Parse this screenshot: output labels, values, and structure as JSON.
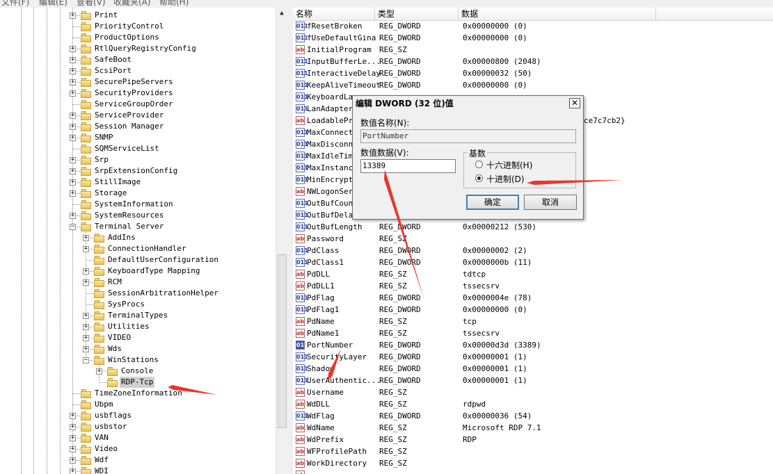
{
  "menubar": {
    "items": [
      "文件(F)",
      "编辑(E)",
      "查看(V)",
      "收藏夹(A)",
      "帮助(H)"
    ]
  },
  "tree": {
    "items": [
      {
        "label": "Print",
        "level": 0,
        "expander": "plus"
      },
      {
        "label": "PriorityControl",
        "level": 0,
        "expander": "none"
      },
      {
        "label": "ProductOptions",
        "level": 0,
        "expander": "none"
      },
      {
        "label": "RtlQueryRegistryConfig",
        "level": 0,
        "expander": "plus"
      },
      {
        "label": "SafeBoot",
        "level": 0,
        "expander": "plus"
      },
      {
        "label": "ScsiPort",
        "level": 0,
        "expander": "plus"
      },
      {
        "label": "SecurePipeServers",
        "level": 0,
        "expander": "plus"
      },
      {
        "label": "SecurityProviders",
        "level": 0,
        "expander": "plus"
      },
      {
        "label": "ServiceGroupOrder",
        "level": 0,
        "expander": "none"
      },
      {
        "label": "ServiceProvider",
        "level": 0,
        "expander": "plus"
      },
      {
        "label": "Session Manager",
        "level": 0,
        "expander": "plus"
      },
      {
        "label": "SNMP",
        "level": 0,
        "expander": "plus"
      },
      {
        "label": "SQMServiceList",
        "level": 0,
        "expander": "none"
      },
      {
        "label": "Srp",
        "level": 0,
        "expander": "plus"
      },
      {
        "label": "SrpExtensionConfig",
        "level": 0,
        "expander": "plus"
      },
      {
        "label": "StillImage",
        "level": 0,
        "expander": "plus"
      },
      {
        "label": "Storage",
        "level": 0,
        "expander": "plus"
      },
      {
        "label": "SystemInformation",
        "level": 0,
        "expander": "none"
      },
      {
        "label": "SystemResources",
        "level": 0,
        "expander": "plus"
      },
      {
        "label": "Terminal Server",
        "level": 0,
        "expander": "minus"
      },
      {
        "label": "AddIns",
        "level": 1,
        "expander": "plus"
      },
      {
        "label": "ConnectionHandler",
        "level": 1,
        "expander": "plus"
      },
      {
        "label": "DefaultUserConfiguration",
        "level": 1,
        "expander": "none"
      },
      {
        "label": "KeyboardType Mapping",
        "level": 1,
        "expander": "plus"
      },
      {
        "label": "RCM",
        "level": 1,
        "expander": "plus"
      },
      {
        "label": "SessionArbitrationHelper",
        "level": 1,
        "expander": "none"
      },
      {
        "label": "SysProcs",
        "level": 1,
        "expander": "none"
      },
      {
        "label": "TerminalTypes",
        "level": 1,
        "expander": "plus"
      },
      {
        "label": "Utilities",
        "level": 1,
        "expander": "plus"
      },
      {
        "label": "VIDEO",
        "level": 1,
        "expander": "plus"
      },
      {
        "label": "Wds",
        "level": 1,
        "expander": "plus"
      },
      {
        "label": "WinStations",
        "level": 1,
        "expander": "minus"
      },
      {
        "label": "Console",
        "level": 2,
        "expander": "plus"
      },
      {
        "label": "RDP-Tcp",
        "level": 2,
        "expander": "none",
        "selected": true
      },
      {
        "label": "TimeZoneInformation",
        "level": 0,
        "expander": "none"
      },
      {
        "label": "Ubpm",
        "level": 0,
        "expander": "none"
      },
      {
        "label": "usbflags",
        "level": 0,
        "expander": "plus"
      },
      {
        "label": "usbstor",
        "level": 0,
        "expander": "plus"
      },
      {
        "label": "VAN",
        "level": 0,
        "expander": "plus"
      },
      {
        "label": "Video",
        "level": 0,
        "expander": "plus"
      },
      {
        "label": "Wdf",
        "level": 0,
        "expander": "plus"
      },
      {
        "label": "WDI",
        "level": 0,
        "expander": "plus"
      }
    ]
  },
  "scrollbar": {
    "up_icon": "▲"
  },
  "list": {
    "columns": {
      "name": "名称",
      "type": "类型",
      "data": "数据"
    },
    "rows": [
      {
        "name": "fResetBroken",
        "type": "REG_DWORD",
        "data": "0x00000000 (0)",
        "icon": "dword"
      },
      {
        "name": "fUseDefaultGina",
        "type": "REG_DWORD",
        "data": "0x00000000 (0)",
        "icon": "dword"
      },
      {
        "name": "InitialProgram",
        "type": "REG_SZ",
        "data": "",
        "icon": "sz"
      },
      {
        "name": "InputBufferLe...",
        "type": "REG_DWORD",
        "data": "0x00000800 (2048)",
        "icon": "dword"
      },
      {
        "name": "InteractiveDelay",
        "type": "REG_DWORD",
        "data": "0x00000032 (50)",
        "icon": "dword"
      },
      {
        "name": "KeepAliveTimeout",
        "type": "REG_DWORD",
        "data": "0x00000000 (0)",
        "icon": "dword"
      },
      {
        "name": "KeyboardLay",
        "type": "",
        "data": "",
        "icon": "dword"
      },
      {
        "name": "LanAdapter",
        "type": "",
        "data": "",
        "icon": "dword"
      },
      {
        "name": "LoadablePro",
        "type": "",
        "data": "ce7c7cb2}",
        "icon": "sz"
      },
      {
        "name": "MaxConnecti",
        "type": "",
        "data": "",
        "icon": "dword"
      },
      {
        "name": "MaxDisconne",
        "type": "",
        "data": "",
        "icon": "dword"
      },
      {
        "name": "MaxIdleTime",
        "type": "",
        "data": "",
        "icon": "dword"
      },
      {
        "name": "MaxInstance",
        "type": "",
        "data": "",
        "icon": "dword"
      },
      {
        "name": "MinEncrypti",
        "type": "",
        "data": "",
        "icon": "dword"
      },
      {
        "name": "NWLogonServ",
        "type": "",
        "data": "",
        "icon": "sz"
      },
      {
        "name": "OutBufCount",
        "type": "",
        "data": "",
        "icon": "dword"
      },
      {
        "name": "OutBufDelay",
        "type": "",
        "data": "",
        "icon": "dword"
      },
      {
        "name": "OutBufLength",
        "type": "REG_DWORD",
        "data": "0x00000212 (530)",
        "icon": "dword"
      },
      {
        "name": "Password",
        "type": "REG_SZ",
        "data": "",
        "icon": "sz"
      },
      {
        "name": "PdClass",
        "type": "REG_DWORD",
        "data": "0x00000002 (2)",
        "icon": "dword"
      },
      {
        "name": "PdClass1",
        "type": "REG_DWORD",
        "data": "0x0000000b (11)",
        "icon": "dword"
      },
      {
        "name": "PdDLL",
        "type": "REG_SZ",
        "data": "tdtcp",
        "icon": "sz"
      },
      {
        "name": "PdDLL1",
        "type": "REG_SZ",
        "data": "tssecsrv",
        "icon": "sz"
      },
      {
        "name": "PdFlag",
        "type": "REG_DWORD",
        "data": "0x0000004e (78)",
        "icon": "dword"
      },
      {
        "name": "PdFlag1",
        "type": "REG_DWORD",
        "data": "0x00000000 (0)",
        "icon": "dword"
      },
      {
        "name": "PdName",
        "type": "REG_SZ",
        "data": "tcp",
        "icon": "sz"
      },
      {
        "name": "PdName1",
        "type": "REG_SZ",
        "data": "tssecsrv",
        "icon": "sz"
      },
      {
        "name": "PortNumber",
        "type": "REG_DWORD",
        "data": "0x00000d3d (3389)",
        "icon": "dword",
        "highlight": true
      },
      {
        "name": "SecurityLayer",
        "type": "REG_DWORD",
        "data": "0x00000001 (1)",
        "icon": "dword"
      },
      {
        "name": "Shadow",
        "type": "REG_DWORD",
        "data": "0x00000001 (1)",
        "icon": "dword"
      },
      {
        "name": "UserAuthentic...",
        "type": "REG_DWORD",
        "data": "0x00000001 (1)",
        "icon": "dword"
      },
      {
        "name": "Username",
        "type": "REG_SZ",
        "data": "",
        "icon": "sz"
      },
      {
        "name": "WdDLL",
        "type": "REG_SZ",
        "data": "rdpwd",
        "icon": "sz"
      },
      {
        "name": "WdFlag",
        "type": "REG_DWORD",
        "data": "0x00000036 (54)",
        "icon": "dword"
      },
      {
        "name": "WdName",
        "type": "REG_SZ",
        "data": "Microsoft RDP 7.1",
        "icon": "sz"
      },
      {
        "name": "WdPrefix",
        "type": "REG_SZ",
        "data": "RDP",
        "icon": "sz"
      },
      {
        "name": "WFProfilePath",
        "type": "REG_SZ",
        "data": "",
        "icon": "sz"
      },
      {
        "name": "WorkDirectory",
        "type": "REG_SZ",
        "data": "",
        "icon": "sz"
      },
      {
        "name": "",
        "type": "",
        "data": "",
        "icon": "sz"
      }
    ]
  },
  "icons": {
    "sz": "ab",
    "dword": "011"
  },
  "dialog": {
    "title": "编辑 DWORD (32 位)值",
    "close_icon": "✕",
    "value_name_label": "数值名称(N):",
    "value_name": "PortNumber",
    "value_data_label": "数值数据(V):",
    "value_data": "13389",
    "base_group_label": "基数",
    "radio_hex_label": "十六进制(H)",
    "radio_dec_label": "十进制(D)",
    "selected_base": "decimal",
    "ok_label": "确定",
    "cancel_label": "取消"
  },
  "annotations": {
    "arrow_color": "#e8372b"
  }
}
